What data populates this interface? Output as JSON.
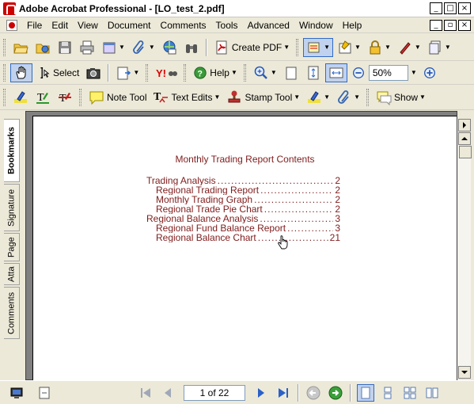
{
  "window": {
    "title": "Adobe Acrobat Professional - [LO_test_2.pdf]",
    "controls": [
      "_",
      "□",
      "×"
    ],
    "doc_controls": [
      "_",
      "▫",
      "×"
    ]
  },
  "menu": [
    "File",
    "Edit",
    "View",
    "Document",
    "Comments",
    "Tools",
    "Advanced",
    "Window",
    "Help"
  ],
  "toolbar1": {
    "create_pdf_label": "Create PDF"
  },
  "toolbar2": {
    "select_label": "Select",
    "help_label": "Help",
    "zoom_value": "50%"
  },
  "toolbar3": {
    "note_tool_label": "Note Tool",
    "text_edits_label": "Text Edits",
    "stamp_tool_label": "Stamp Tool",
    "show_label": "Show"
  },
  "side_tabs": [
    "Bookmarks",
    "Signature",
    "Page",
    "Atta",
    "Comments"
  ],
  "document": {
    "title": "Monthly Trading Report Contents",
    "toc": [
      {
        "text": "Trading Analysis",
        "page": "2",
        "level": 1
      },
      {
        "text": "Regional Trading Report",
        "page": "2",
        "level": 2
      },
      {
        "text": "Monthly Trading Graph",
        "page": "2",
        "level": 2
      },
      {
        "text": "Regional Trade Pie Chart",
        "page": "2",
        "level": 2
      },
      {
        "text": "Regional Balance Analysis",
        "page": "3",
        "level": 1
      },
      {
        "text": "Regional Fund Balance Report",
        "page": "3",
        "level": 2
      },
      {
        "text": "Regional Balance Chart",
        "page": "21",
        "level": 2
      }
    ]
  },
  "status": {
    "page_indicator": "1 of 22"
  },
  "colors": {
    "doc_text": "#7f1c1c",
    "chrome": "#ece9d8",
    "accent": "#316ac5"
  }
}
